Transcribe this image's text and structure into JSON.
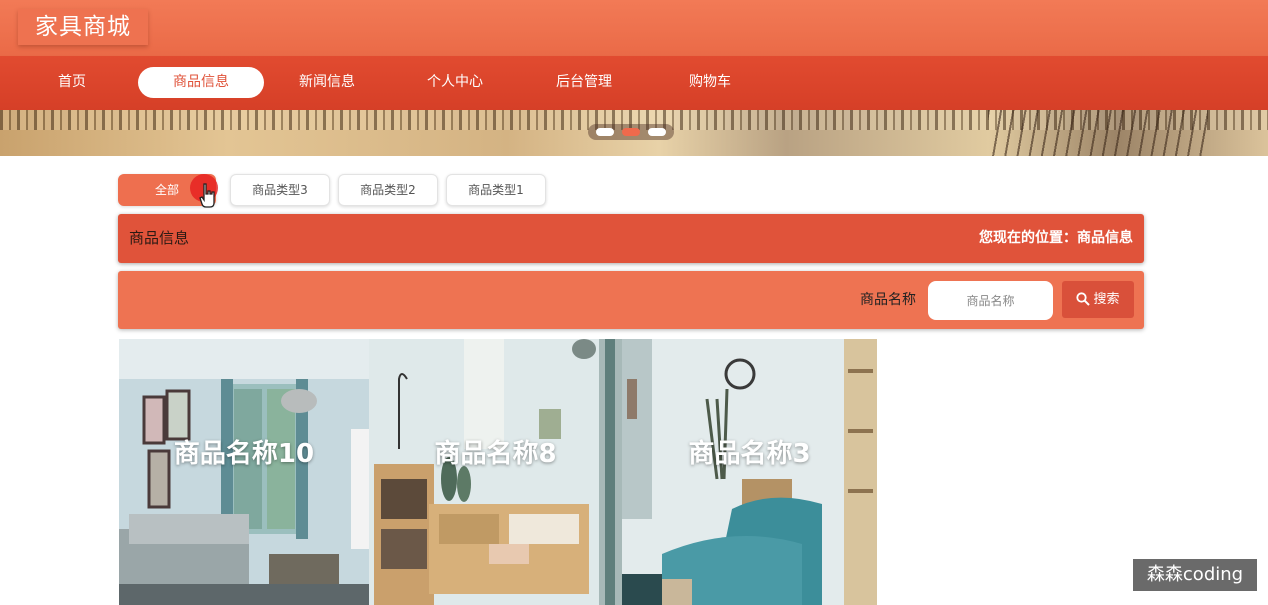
{
  "app": {
    "logo": "家具商城"
  },
  "nav": {
    "items": [
      {
        "label": "首页",
        "active": false
      },
      {
        "label": "商品信息",
        "active": true
      },
      {
        "label": "新闻信息",
        "active": false
      },
      {
        "label": "个人中心",
        "active": false
      },
      {
        "label": "后台管理",
        "active": false
      },
      {
        "label": "购物车",
        "active": false
      }
    ]
  },
  "banner": {
    "slide_count": 3,
    "active_slide": 2
  },
  "categories": [
    {
      "label": "全部",
      "active": true
    },
    {
      "label": "商品类型3",
      "active": false
    },
    {
      "label": "商品类型2",
      "active": false
    },
    {
      "label": "商品类型1",
      "active": false
    }
  ],
  "section": {
    "title": "商品信息",
    "location": "您现在的位置：商品信息"
  },
  "search": {
    "label": "商品名称",
    "placeholder": "商品名称",
    "value": "",
    "button_label": "搜索",
    "button_icon": "search-icon"
  },
  "products": [
    {
      "name": "商品名称10"
    },
    {
      "name": "商品名称8"
    },
    {
      "name": "商品名称3"
    }
  ],
  "watermark": "森森coding",
  "colors": {
    "header": "#ea6a47",
    "nav": "#d63f27",
    "accent": "#e0533a",
    "search_bar": "#ee7352"
  }
}
